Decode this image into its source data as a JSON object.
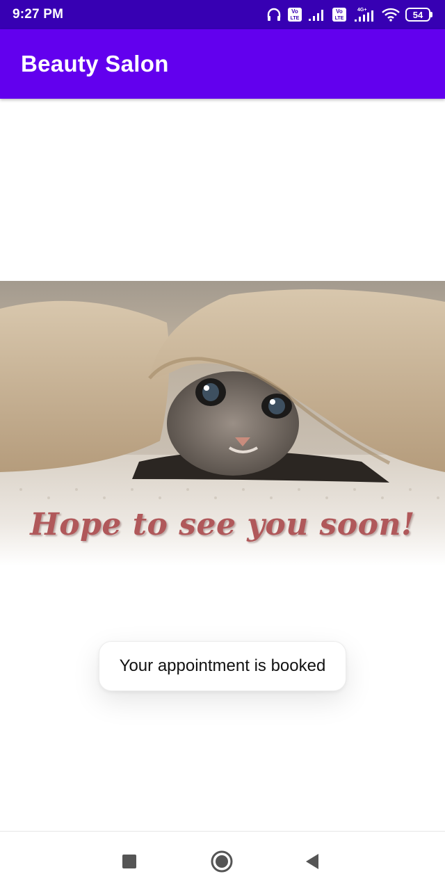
{
  "status_bar": {
    "time": "9:27 PM",
    "battery_level": "54",
    "icons": [
      "headphones-icon",
      "volte-icon",
      "signal-icon",
      "volte-icon",
      "signal-4g-icon",
      "wifi-icon",
      "battery-icon"
    ],
    "network_label_1": "Vo LTE",
    "network_label_2": "Vo LTE",
    "network_type": "4G+"
  },
  "app_bar": {
    "title": "Beauty Salon"
  },
  "hero": {
    "caption": "Hope to see you soon!"
  },
  "toast": {
    "message": "Your appointment is booked"
  },
  "nav_bar": {
    "buttons": [
      "recents-icon",
      "home-icon",
      "back-icon"
    ]
  },
  "colors": {
    "status_bar": "#3700b3",
    "app_bar": "#6200ee",
    "caption": "#b0585a"
  }
}
